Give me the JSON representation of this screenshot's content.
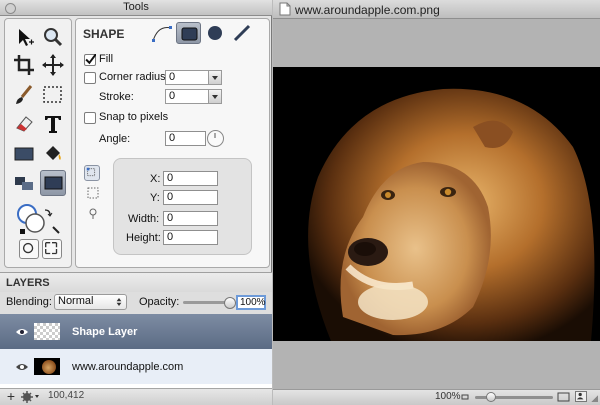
{
  "tools_window": {
    "title": "Tools"
  },
  "shape_panel": {
    "header": "SHAPE",
    "fill_label": "Fill",
    "fill_checked": true,
    "corner_radius_label": "Corner radius:",
    "corner_radius_value": "0",
    "stroke_label": "Stroke:",
    "stroke_value": "0",
    "snap_label": "Snap to pixels",
    "angle_label": "Angle:",
    "angle_value": "0",
    "x_label": "X:",
    "x_value": "0",
    "y_label": "Y:",
    "y_value": "0",
    "width_label": "Width:",
    "width_value": "0",
    "height_label": "Height:",
    "height_value": "0"
  },
  "layers": {
    "title": "LAYERS",
    "blending_label": "Blending:",
    "blending_value": "Normal",
    "opacity_label": "Opacity:",
    "opacity_value": "100%",
    "opacity_fraction": 1.0,
    "items": [
      {
        "name": "Shape Layer",
        "selected": true
      },
      {
        "name": "www.aroundapple.com",
        "selected": false
      }
    ],
    "footer_coords": "100,412"
  },
  "document": {
    "title": "www.aroundapple.com.png",
    "zoom": "100%"
  },
  "colors": {
    "selection": "#5b6b84",
    "accent": "#3f7fd6"
  }
}
